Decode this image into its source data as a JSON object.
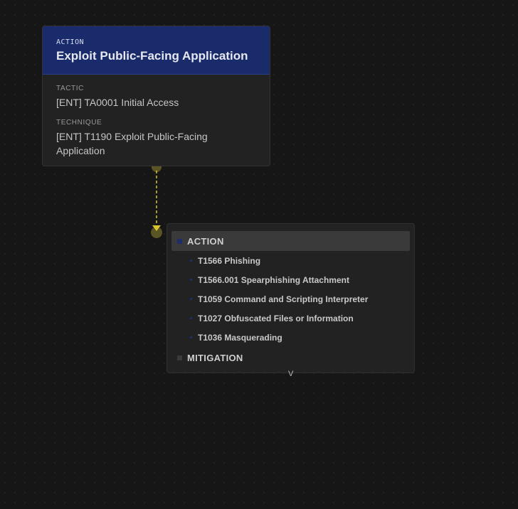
{
  "node": {
    "kind": "ACTION",
    "title": "Exploit Public-Facing Application",
    "fields": [
      {
        "label": "TACTIC",
        "value": "[ENT] TA0001 Initial Access"
      },
      {
        "label": "TECHNIQUE",
        "value": "[ENT] T1190 Exploit Public-Facing Application"
      }
    ]
  },
  "colors": {
    "node_header": "#1a2b6b",
    "edge": "#d9c22e",
    "handle": "#5a5524",
    "action_square": "#1f2d6b",
    "mitigation_square": "#3a3a3a"
  },
  "menu": {
    "groups": [
      {
        "label": "ACTION",
        "active": true,
        "items": [
          "T1566 Phishing",
          "T1566.001 Spearphishing Attachment",
          "T1059 Command and Scripting Interpreter",
          "T1027 Obfuscated Files or Information",
          "T1036 Masquerading"
        ]
      },
      {
        "label": "MITIGATION",
        "active": false,
        "items": []
      }
    ],
    "caret": "V"
  }
}
